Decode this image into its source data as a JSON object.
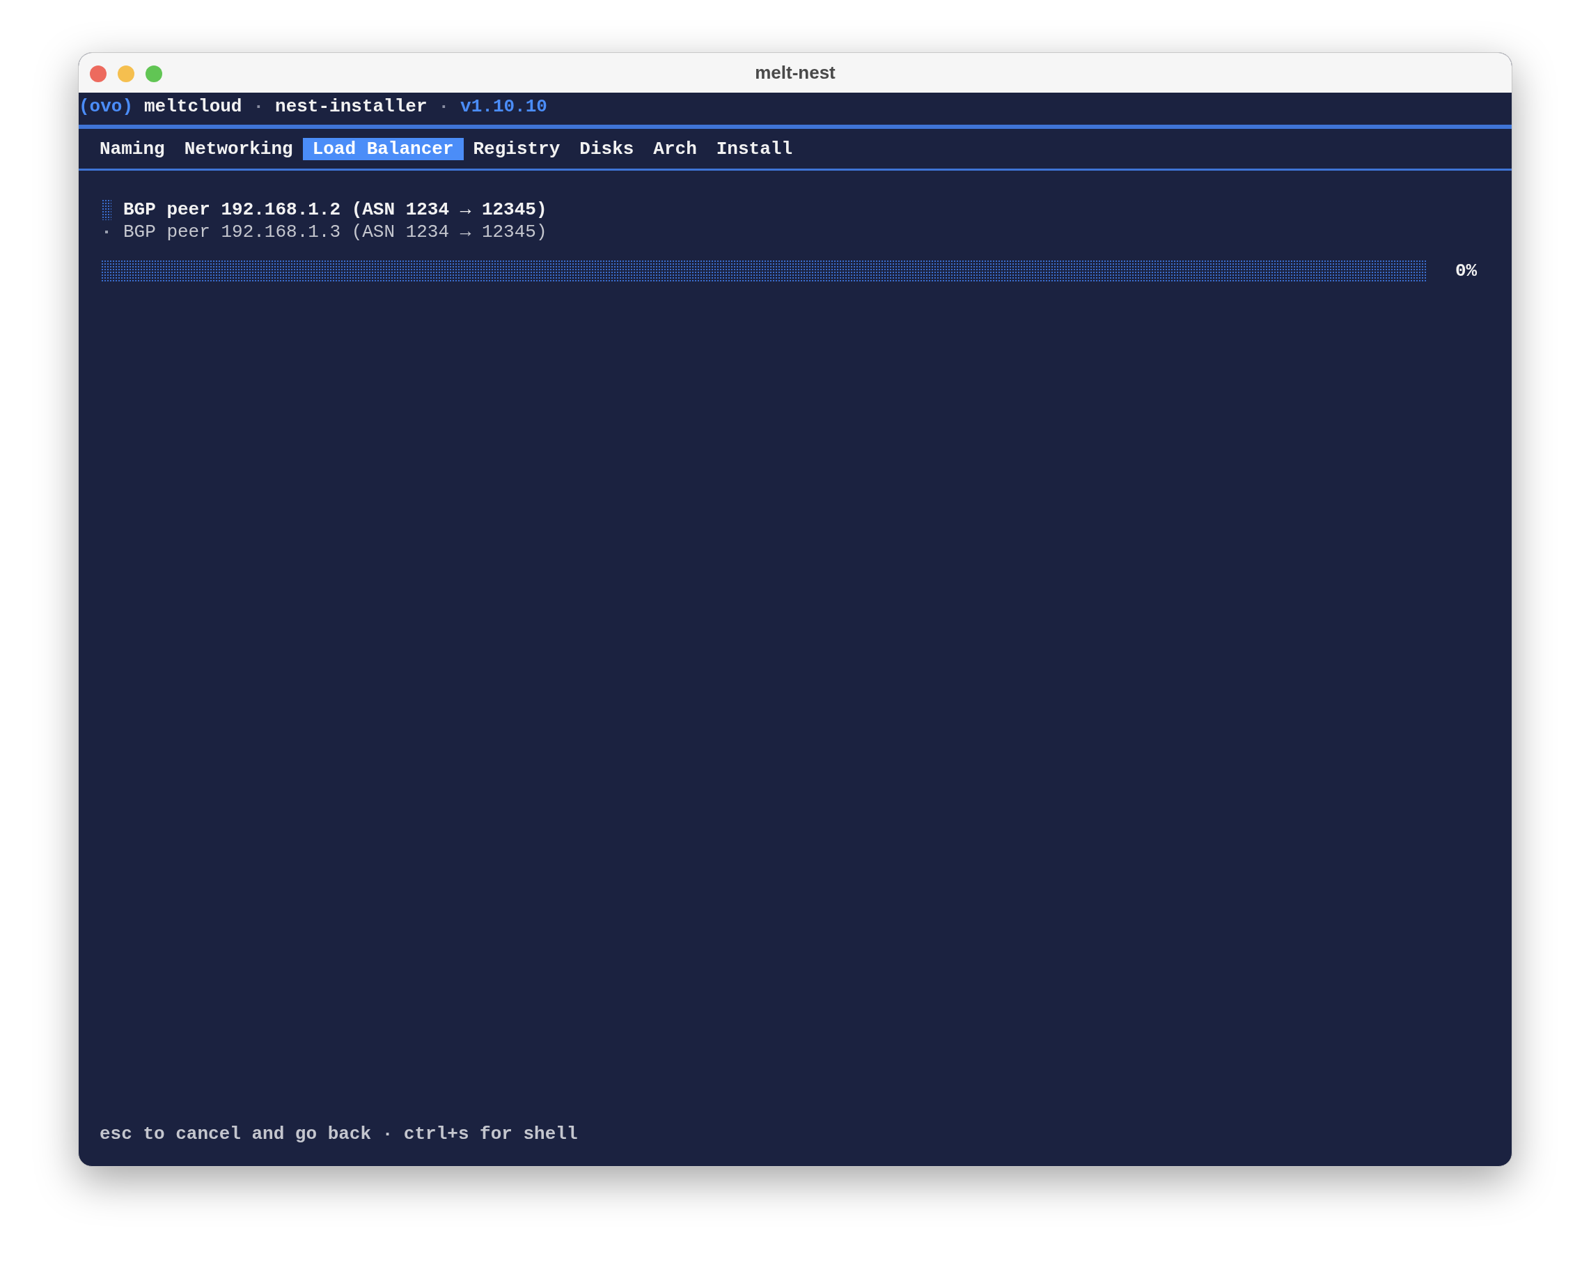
{
  "window": {
    "title": "melt-nest"
  },
  "header": [
    {
      "kind": "logo",
      "text": "(ovo)"
    },
    {
      "kind": "name",
      "text": "meltcloud"
    },
    {
      "kind": "sep",
      "text": "·"
    },
    {
      "kind": "name",
      "text": "nest-installer"
    },
    {
      "kind": "sep",
      "text": "·"
    },
    {
      "kind": "version",
      "text": "v1.10.10"
    }
  ],
  "tabs": [
    {
      "label": "Naming",
      "selected": false
    },
    {
      "label": "Networking",
      "selected": false
    },
    {
      "label": "Load Balancer",
      "selected": true
    },
    {
      "label": "Registry",
      "selected": false
    },
    {
      "label": "Disks",
      "selected": false
    },
    {
      "label": "Arch",
      "selected": false
    },
    {
      "label": "Install",
      "selected": false
    }
  ],
  "peers": [
    {
      "label": "BGP peer 192.168.1.2 (ASN 1234 → 12345)",
      "selected": true
    },
    {
      "label": "BGP peer 192.168.1.3 (ASN 1234 → 12345)",
      "selected": false
    }
  ],
  "progress": {
    "level": 0,
    "reading": "0%"
  },
  "footer": "esc to cancel and go back · ctrl+s for shell"
}
